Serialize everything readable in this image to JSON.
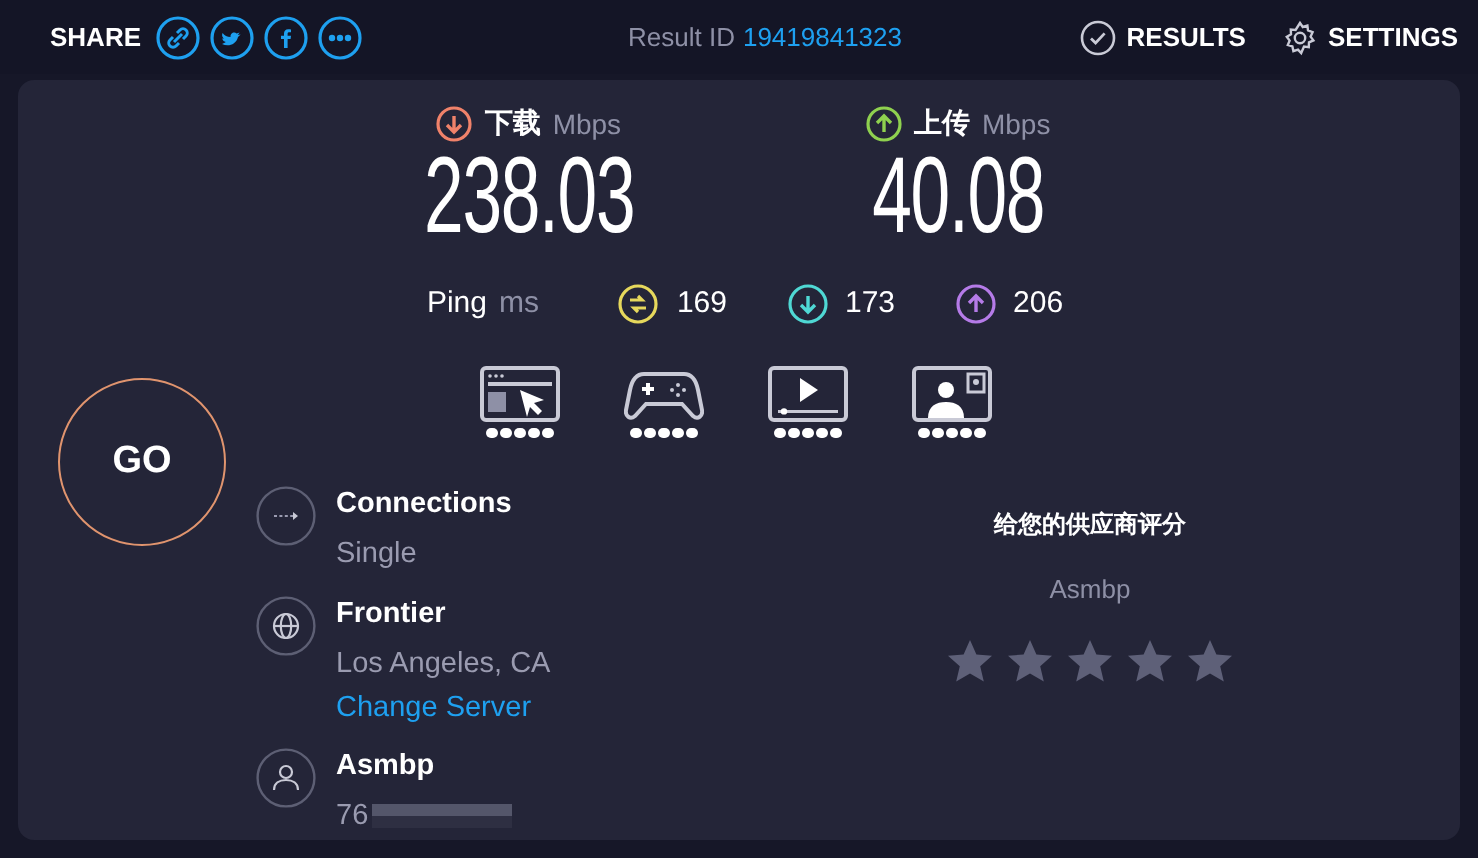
{
  "share": {
    "label": "SHARE",
    "buttons": [
      {
        "kind": "link"
      },
      {
        "kind": "twitter"
      },
      {
        "kind": "facebook"
      },
      {
        "kind": "more"
      }
    ]
  },
  "result_id": {
    "label": "Result ID",
    "value": "19419841323"
  },
  "nav": [
    {
      "kind": "results",
      "label": "RESULTS"
    },
    {
      "kind": "settings",
      "label": "SETTINGS"
    }
  ],
  "speeds": [
    {
      "kind": "download",
      "label": "下载",
      "unit": "Mbps",
      "value": "238.03",
      "color": "#f0826a"
    },
    {
      "kind": "upload",
      "label": "上传",
      "unit": "Mbps",
      "value": "40.08",
      "color": "#8fd14f"
    }
  ],
  "ping": {
    "label": "Ping",
    "unit": "ms",
    "values": [
      {
        "kind": "idle",
        "value": "169",
        "color": "#e6d85c"
      },
      {
        "kind": "download",
        "value": "173",
        "color": "#4fd8d4"
      },
      {
        "kind": "upload",
        "value": "206",
        "color": "#b57be8"
      }
    ]
  },
  "apps": [
    {
      "kind": "browsing",
      "stars": 5
    },
    {
      "kind": "gaming",
      "stars": 5
    },
    {
      "kind": "streaming",
      "stars": 5
    },
    {
      "kind": "video_chat",
      "stars": 5
    }
  ],
  "go": {
    "label": "GO"
  },
  "info": [
    {
      "kind": "connections",
      "title": "Connections",
      "detail": "Single"
    },
    {
      "kind": "server",
      "title": "Frontier",
      "detail": "Los Angeles, CA",
      "link": "Change Server"
    },
    {
      "kind": "user",
      "title": "Asmbp",
      "detail": "76",
      "redacted": true
    }
  ],
  "rating": {
    "title": "给您的供应商评分",
    "provider": "Asmbp"
  }
}
